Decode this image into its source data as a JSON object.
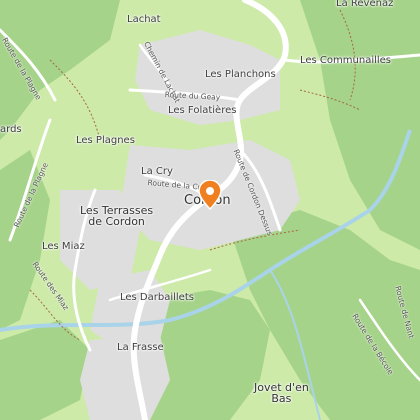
{
  "map": {
    "marker": {
      "icon": "location-pin-icon",
      "color": "#f07f1f"
    },
    "colors": {
      "forest": "#a6d38a",
      "meadow": "#cdeaa9",
      "urban": "#dedede",
      "road": "#ffffff",
      "river": "#a9d3e8",
      "path": "#a5683e"
    },
    "places": {
      "lachat": "Lachat",
      "la_revenaz": "La Revenaz",
      "les_planchons": "Les Planchons",
      "les_communailles": "Les Communailles",
      "les_folatieres": "Les Folatières",
      "ards": "ards",
      "les_plagnes": "Les Plagnes",
      "la_cry": "La Cry",
      "cordon": "Cordon",
      "les_terrasses_line1": "Les Terrasses",
      "les_terrasses_line2": "de Cordon",
      "les_miaz": "Les Miaz",
      "les_darbaillets": "Les Darbaillets",
      "la_frasse": "La Frasse",
      "jovet_line1": "Jovet d'en",
      "jovet_line2": "Bas"
    },
    "roads": {
      "chemin_de_lachat": "Chemin de Lachat",
      "route_du_geay": "Route du Geay",
      "route_de_la_plagne": "Route de la Plagne",
      "route_de_la_cry": "Route de la Cry",
      "route_de_cordon_dessus": "Route de Cordon Dessus",
      "route_de_la_plagne_west": "Route de la Plagne",
      "route_des_miaz": "Route des Miaz",
      "route_de_la_becole": "Route de la Bécole",
      "route_de_nant": "Route de Nant"
    }
  }
}
